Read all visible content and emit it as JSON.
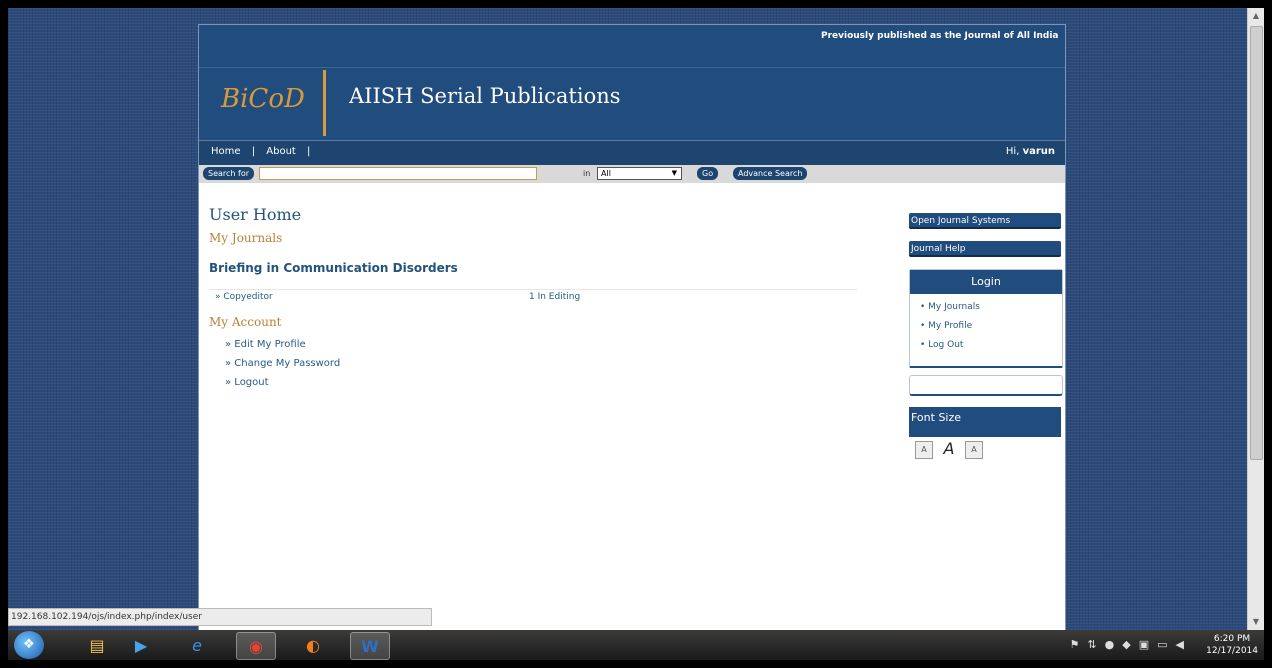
{
  "topline": {
    "text": "Previously published as the Journal of All India In"
  },
  "header": {
    "logo": "BiCoD",
    "title": "AIISH Serial Publications"
  },
  "nav": {
    "home": "Home",
    "sep1": "|",
    "about": "About",
    "sep2": "|",
    "greeting": "Hi,",
    "username": "varun"
  },
  "search": {
    "label": "Search for",
    "value": "",
    "in_label": "in",
    "scope": "All",
    "go": "Go",
    "advanced": "Advance Search"
  },
  "main": {
    "title": "User Home",
    "my_journals": "My Journals",
    "journal_name": "Briefing in Communication Disorders",
    "role": "» Copyeditor",
    "status": "1 In Editing",
    "my_account": "My Account",
    "account_links": [
      "» Edit My Profile",
      "» Change My Password",
      "» Logout"
    ]
  },
  "sidebar": {
    "ojs": "Open Journal Systems",
    "help": "Journal Help",
    "login_title": "Login",
    "login_links": [
      "• My Journals",
      "• My Profile",
      "• Log Out"
    ],
    "font_size": "Font Size",
    "font_icons": [
      "A",
      "A",
      "A"
    ]
  },
  "statusbar": {
    "url": "192.168.102.194/ojs/index.php/index/user"
  },
  "taskbar": {
    "time": "6:20 PM",
    "date": "12/17/2014"
  }
}
